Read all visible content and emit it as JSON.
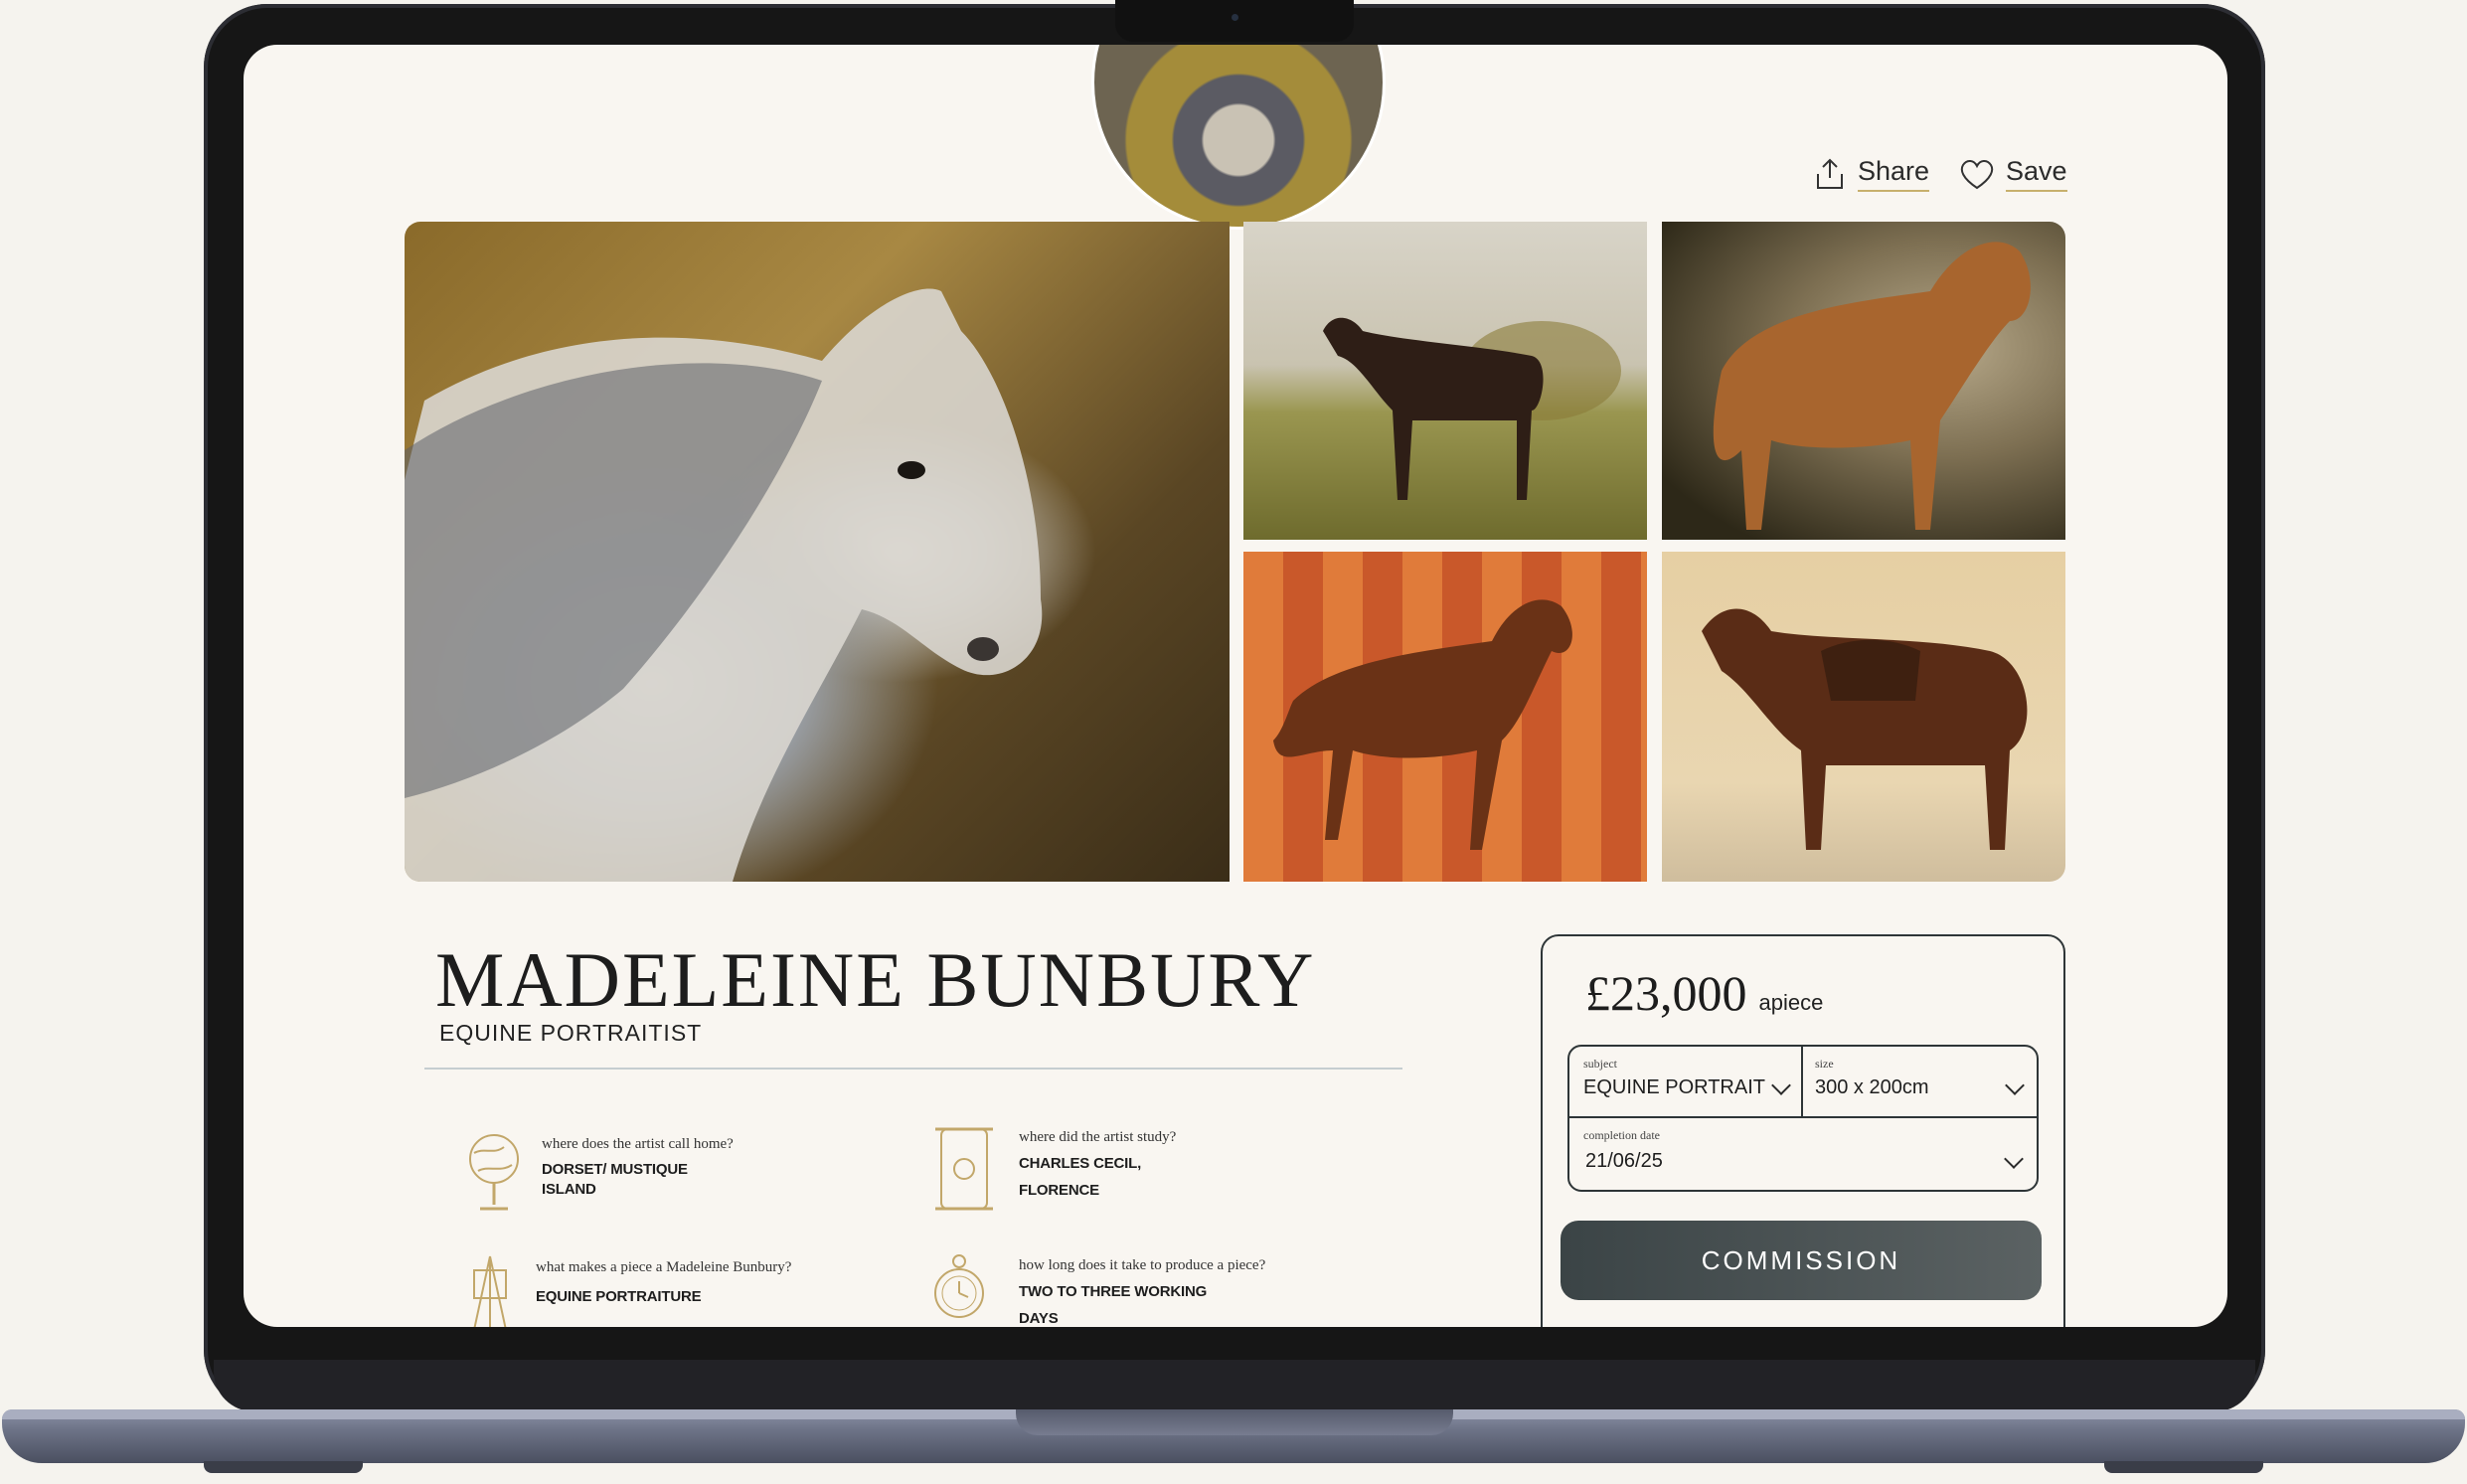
{
  "header": {
    "share_label": "Share",
    "save_label": "Save"
  },
  "artist": {
    "name": "MADELEINE BUNBURY",
    "role": "EQUINE PORTRAITIST"
  },
  "facts": [
    {
      "question": "where does the artist call home?",
      "answer_line1": "DORSET/ MUSTIQUE",
      "answer_line2": "ISLAND",
      "icon": "globe-icon"
    },
    {
      "question": "where did the artist study?",
      "answer_line1": "CHARLES CECIL,",
      "answer_line2": "FLORENCE",
      "icon": "scroll-icon"
    },
    {
      "question": "what makes a piece a Madeleine Bunbury?",
      "answer_line1": "EQUINE PORTRAITURE",
      "answer_line2": "",
      "icon": "easel-icon"
    },
    {
      "question": "how long does it take to produce a piece?",
      "answer_line1": "TWO TO THREE WORKING",
      "answer_line2": "DAYS",
      "icon": "pocket-watch-icon"
    }
  ],
  "purchase": {
    "price": "£23,000",
    "price_unit": "apiece",
    "subject_label": "subject",
    "subject_value": "EQUINE PORTRAIT",
    "size_label": "size",
    "size_value": "300 x 200cm",
    "date_label": "completion date",
    "date_value": "21/06/25",
    "commission_label": "COMMISSION"
  },
  "colors": {
    "page_bg": "#f9f6f1",
    "accent_gold": "#c7b06d",
    "button_dark": "#3b4446"
  }
}
